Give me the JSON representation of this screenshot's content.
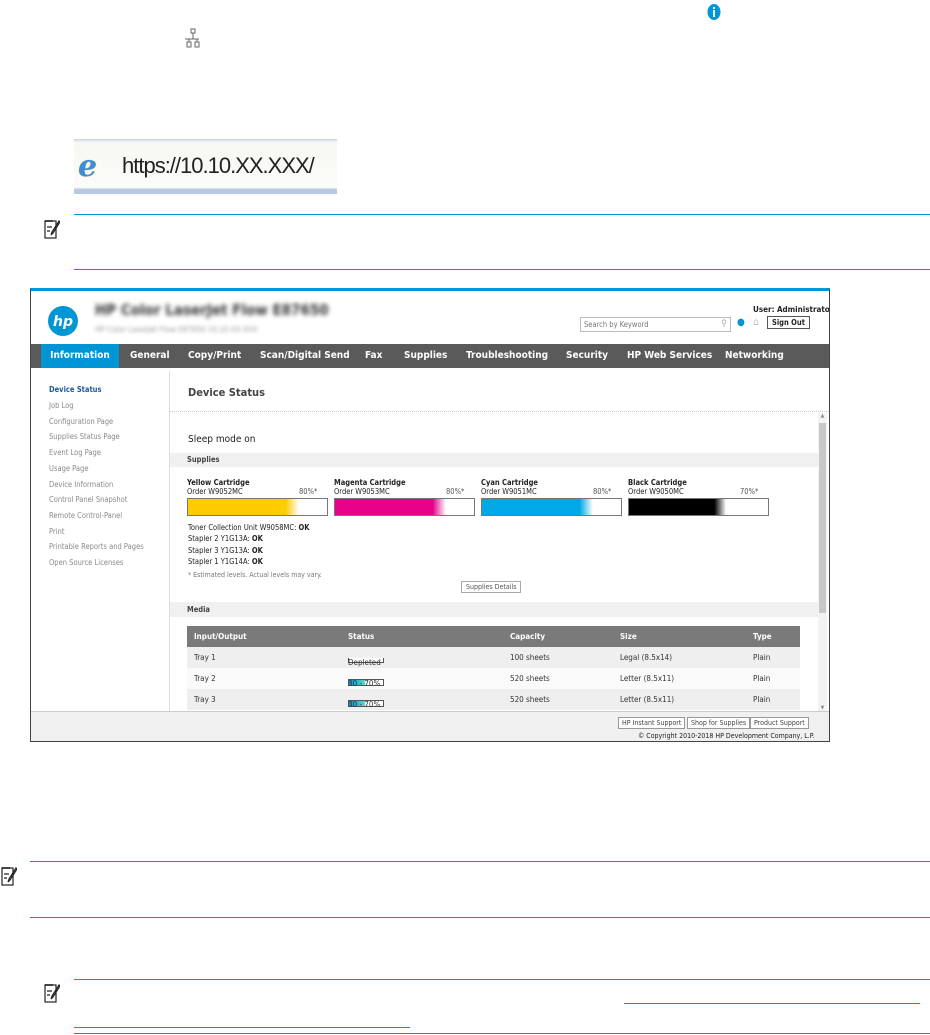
{
  "doc": {
    "icons": [
      "info-icon",
      "network-icon",
      "note-icon"
    ],
    "url_bar": "https://10.10.XX.XXX/",
    "accent": "#0096d6"
  },
  "ews": {
    "product_title": "HP Color LaserJet Flow E87650",
    "product_subtitle": "HP Color LaserJet Flow E87650     10.10.XX.XXX",
    "user": "User: Administrator",
    "search_placeholder": "Search by Keyword",
    "sign_out": "Sign Out",
    "tabs": [
      "Information",
      "General",
      "Copy/Print",
      "Scan/Digital Send",
      "Fax",
      "Supplies",
      "Troubleshooting",
      "Security",
      "HP Web Services",
      "Networking"
    ],
    "sidebar": [
      "Device Status",
      "Job Log",
      "Configuration Page",
      "Supplies Status Page",
      "Event Log Page",
      "Usage Page",
      "Device Information",
      "Control Panel Snapshot",
      "Remote Control-Panel",
      "Print",
      "Printable Reports and Pages",
      "Open Source Licenses"
    ],
    "page_title": "Device Status",
    "sleep": "Sleep mode on",
    "supplies_heading": "Supplies",
    "cartridges": [
      {
        "name": "Yellow Cartridge",
        "order": "Order W9052MC",
        "level": "80%*",
        "pct": 80,
        "color": "#ffcc00"
      },
      {
        "name": "Magenta Cartridge",
        "order": "Order W9053MC",
        "level": "80%*",
        "pct": 80,
        "color": "#e6008a"
      },
      {
        "name": "Cyan Cartridge",
        "order": "Order W9051MC",
        "level": "80%*",
        "pct": 80,
        "color": "#00a8e8"
      },
      {
        "name": "Black Cartridge",
        "order": "Order W9050MC",
        "level": "70%*",
        "pct": 70,
        "color": "#000000"
      }
    ],
    "other_supplies": [
      {
        "label": "Toner Collection Unit W9058MC: ",
        "status": "OK"
      },
      {
        "label": "Stapler 2 Y1G13A: ",
        "status": "OK"
      },
      {
        "label": "Stapler 3 Y1G13A: ",
        "status": "OK"
      },
      {
        "label": "Stapler 1 Y1G14A: ",
        "status": "OK"
      }
    ],
    "estimate_note": "* Estimated levels. Actual levels may vary.",
    "supplies_details": "Supplies Details",
    "media_heading": "Media",
    "media_columns": [
      "Input/Output",
      "Status",
      "Capacity",
      "Size",
      "Type"
    ],
    "media_rows": [
      {
        "io": "Tray 1",
        "status": "Depleted",
        "pct": 0,
        "capacity": "100 sheets",
        "size": "Legal (8.5x14)",
        "type": "Plain"
      },
      {
        "io": "Tray 2",
        "status": "30 - 70%",
        "pct": 50,
        "capacity": "520 sheets",
        "size": "Letter (8.5x11)",
        "type": "Plain"
      },
      {
        "io": "Tray 3",
        "status": "30 - 70%",
        "pct": 50,
        "capacity": "520 sheets",
        "size": "Letter (8.5x11)",
        "type": "Plain"
      }
    ],
    "footer_buttons": [
      "HP Instant Support",
      "Shop for Supplies",
      "Product Support"
    ],
    "copyright": "© Copyright 2010-2018 HP Development Company, L.P."
  }
}
